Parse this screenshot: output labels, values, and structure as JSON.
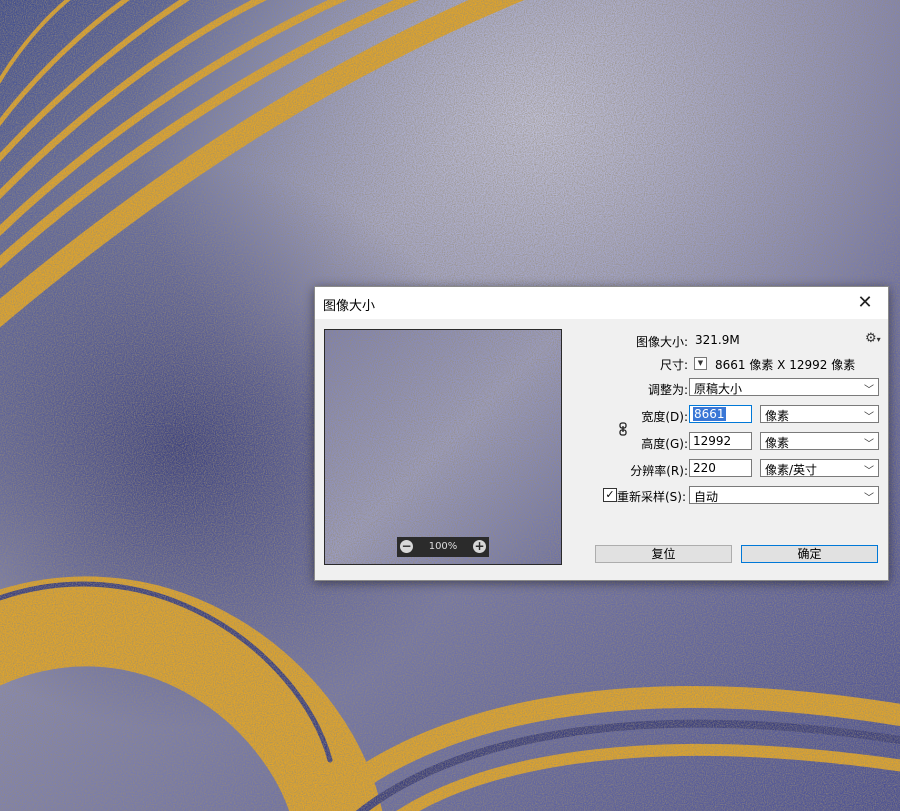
{
  "dialog": {
    "title": "图像大小",
    "close_glyph": "✕",
    "image_size_label": "图像大小:",
    "image_size_value": "321.9M",
    "gear_icon": "gear-icon",
    "dimensions_label": "尺寸:",
    "dimensions_value": "8661 像素  X  12992 像素",
    "fit_to_label": "调整为:",
    "fit_to_value": "原稿大小",
    "width_label": "宽度(D):",
    "width_value": "8661",
    "width_unit": "像素",
    "height_label": "高度(G):",
    "height_value": "12992",
    "height_unit": "像素",
    "resolution_label": "分辨率(R):",
    "resolution_value": "220",
    "resolution_unit": "像素/英寸",
    "resample_label": "重新采样(S):",
    "resample_checked": "✓",
    "resample_value": "自动",
    "reset_button": "复位",
    "ok_button": "确定",
    "zoom_level": "100%",
    "zoom_out_glyph": "−",
    "zoom_in_glyph": "+"
  },
  "colors": {
    "background_blue": "#4b4f8a",
    "gold": "#e0a42a",
    "selection": "#3a77d6",
    "primary_border": "#0078d7"
  }
}
